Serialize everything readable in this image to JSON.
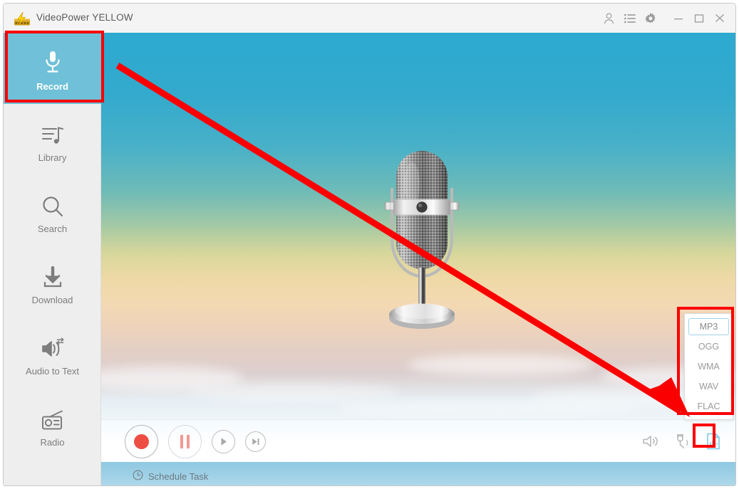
{
  "window": {
    "title": "VideoPower YELLOW",
    "app_icon": "lightning-bolt-film-icon",
    "title_buttons": [
      {
        "name": "account-icon",
        "label": "Account"
      },
      {
        "name": "list-icon",
        "label": "List"
      },
      {
        "name": "gear-icon",
        "label": "Settings"
      },
      {
        "name": "minimize-icon",
        "label": "Minimize"
      },
      {
        "name": "maximize-icon",
        "label": "Maximize"
      },
      {
        "name": "close-icon",
        "label": "Close"
      }
    ]
  },
  "sidebar": {
    "active_item": "Record",
    "items": [
      {
        "label": "Record",
        "icon": "microphone-icon",
        "active": true
      },
      {
        "label": "Library",
        "icon": "music-list-icon",
        "active": false
      },
      {
        "label": "Search",
        "icon": "magnifier-icon",
        "active": false
      },
      {
        "label": "Download",
        "icon": "download-arrow-icon",
        "active": false
      },
      {
        "label": "Audio to Text",
        "icon": "speaker-convert-icon",
        "active": false
      },
      {
        "label": "Radio",
        "icon": "radio-icon",
        "active": false
      }
    ]
  },
  "stage": {
    "artwork": "studio-microphone-illustration"
  },
  "transport": {
    "buttons": [
      {
        "name": "record-button",
        "label": "Record"
      },
      {
        "name": "pause-button",
        "label": "Pause"
      },
      {
        "name": "play-button",
        "label": "Play"
      },
      {
        "name": "next-button",
        "label": "Next"
      }
    ],
    "right_icons": [
      {
        "name": "speaker-icon",
        "label": "System Sound"
      },
      {
        "name": "microphone-plug-icon",
        "label": "Microphone"
      },
      {
        "name": "output-format-icon",
        "label": "Output Format"
      }
    ]
  },
  "schedule": {
    "label": "Schedule Task",
    "icon": "clock-icon"
  },
  "format_menu": {
    "selected": "MP3",
    "options": [
      "MP3",
      "OGG",
      "WMA",
      "WAV",
      "FLAC"
    ]
  },
  "annotations": {
    "accent_color": "#fb0000",
    "highlight_boxes": [
      {
        "name": "record-sidebar-highlight"
      },
      {
        "name": "format-menu-highlight"
      },
      {
        "name": "format-icon-highlight"
      }
    ],
    "arrow": {
      "name": "pointer-arrow",
      "from": "record-sidebar-highlight",
      "to": "format-icon-highlight"
    }
  }
}
